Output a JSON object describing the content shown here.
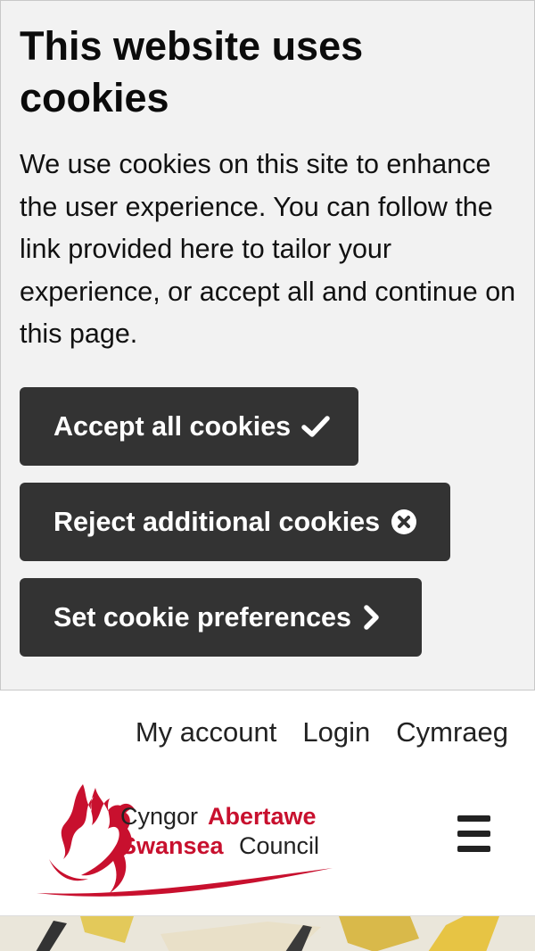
{
  "cookie_banner": {
    "title": "This website uses cookies",
    "body": "We use cookies on this site to enhance the user experience. You can follow the link provided here to tailor your experience, or accept all and continue on this page.",
    "accept_label": "Accept all cookies",
    "accept_icon": "check-icon",
    "reject_label": "Reject additional cookies",
    "reject_icon": "close-circle-icon",
    "prefs_label": "Set cookie preferences",
    "prefs_icon": "chevron-right-icon",
    "button_color": "#333333",
    "background_color": "#f2f2f2"
  },
  "top_links": {
    "my_account": "My account",
    "login": "Login",
    "language": "Cymraeg"
  },
  "header": {
    "logo": {
      "line1_a": "Cyngor",
      "line1_b": "Abertawe",
      "line2_a": "Swansea",
      "line2_b": "Council",
      "brand_color": "#c8102e"
    },
    "menu_icon": "hamburger-menu-icon"
  }
}
